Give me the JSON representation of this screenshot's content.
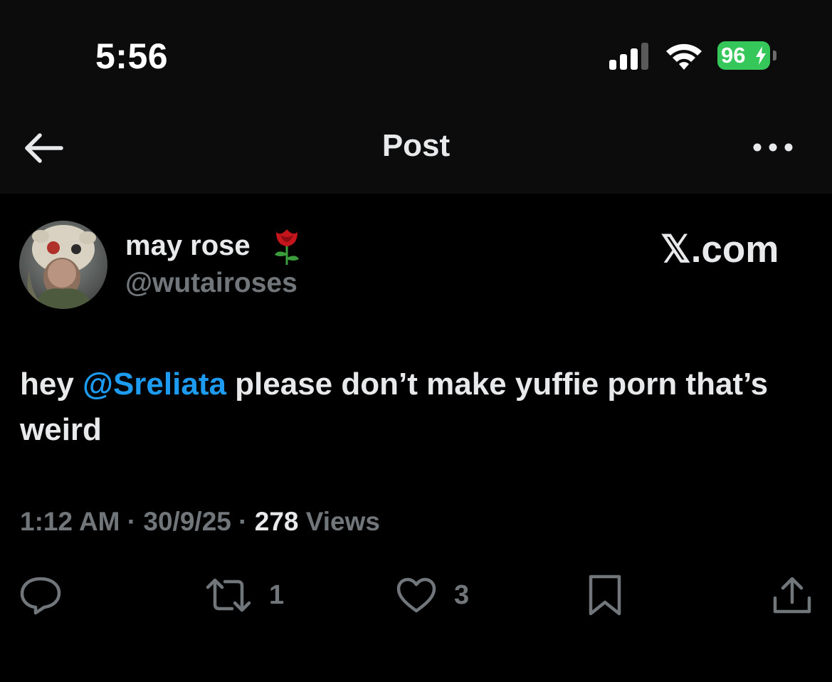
{
  "status_bar": {
    "time": "5:56",
    "battery_percent": "96",
    "battery_charging": true,
    "battery_color": "#35c759",
    "signal_bars_filled": 3,
    "signal_bars_total": 4
  },
  "header": {
    "title": "Post",
    "back_icon": "arrow-left-icon",
    "more_icon": "ellipsis-icon"
  },
  "post": {
    "author": {
      "display_name": "may rose",
      "emoji_icon": "rose-icon",
      "handle": "@wutairoses"
    },
    "watermark": "𝕏.com",
    "text": {
      "before_mention": "hey ",
      "mention": "@Sreliata",
      "after_mention": " please don’t make yuffie porn that’s weird"
    },
    "meta": {
      "time": "1:12 AM",
      "separator": "·",
      "date": "30/9/25",
      "views_count": "278",
      "views_label": "Views"
    },
    "actions": {
      "reply_icon": "reply-icon",
      "repost_icon": "repost-icon",
      "repost_count": "1",
      "like_icon": "heart-icon",
      "like_count": "3",
      "bookmark_icon": "bookmark-icon",
      "share_icon": "share-icon"
    }
  },
  "colors": {
    "background": "#000000",
    "header_background": "#0c0c0c",
    "text_primary": "#e7e9ea",
    "text_secondary": "#71767b",
    "mention": "#1d9bf0"
  }
}
